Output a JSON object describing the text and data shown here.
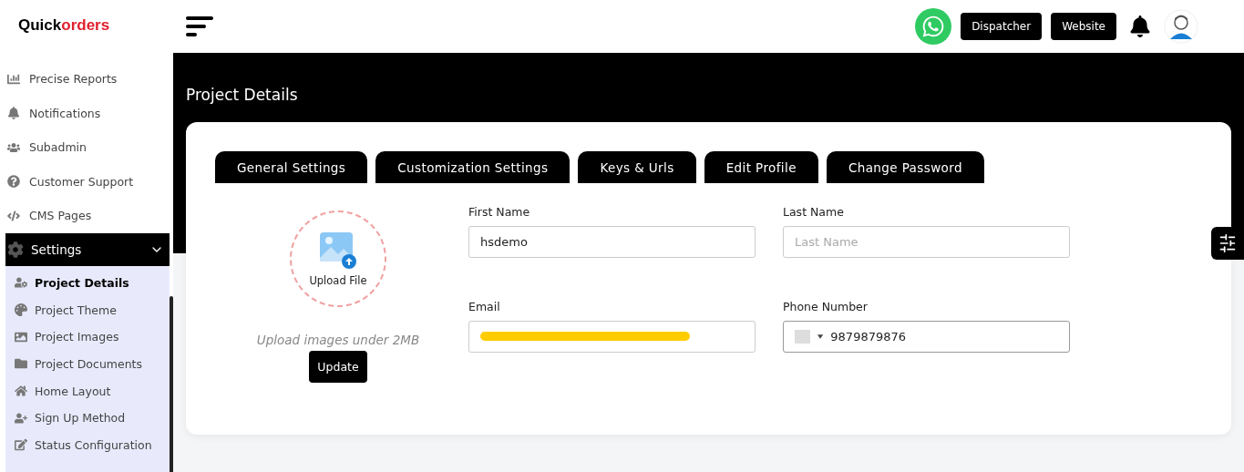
{
  "logo": {
    "first": "Quick",
    "second": "orders"
  },
  "sidebar": {
    "items": [
      {
        "label": "Precise Reports"
      },
      {
        "label": "Notifications"
      },
      {
        "label": "Subadmin"
      },
      {
        "label": "Customer Support"
      },
      {
        "label": "CMS Pages"
      }
    ],
    "group": {
      "label": "Settings",
      "expanded": true,
      "children": [
        {
          "label": "Project Details",
          "selected": true
        },
        {
          "label": "Project Theme",
          "selected": false
        },
        {
          "label": "Project Images",
          "selected": false
        },
        {
          "label": "Project Documents",
          "selected": false
        },
        {
          "label": "Home Layout",
          "selected": false
        },
        {
          "label": "Sign Up Method",
          "selected": false
        },
        {
          "label": "Status Configuration",
          "selected": false
        }
      ]
    }
  },
  "header": {
    "buttons": [
      "Dispatcher",
      "Website"
    ]
  },
  "page": {
    "title": "Project Details"
  },
  "tabs": [
    {
      "label": "General Settings"
    },
    {
      "label": "Customization Settings"
    },
    {
      "label": "Keys & Urls"
    },
    {
      "label": "Edit Profile"
    },
    {
      "label": "Change Password"
    }
  ],
  "upload": {
    "label": "Upload File",
    "hint": "Upload images under 2MB",
    "button": "Update"
  },
  "form": {
    "fields": [
      {
        "label": "First Name",
        "value": "hsdemo",
        "kind": "text"
      },
      {
        "label": "Last Name",
        "placeholder": "Last Name",
        "kind": "text"
      },
      {
        "label": "Email",
        "kind": "redacted"
      },
      {
        "label": "Phone Number",
        "value": "9879879876",
        "kind": "phone"
      }
    ]
  }
}
